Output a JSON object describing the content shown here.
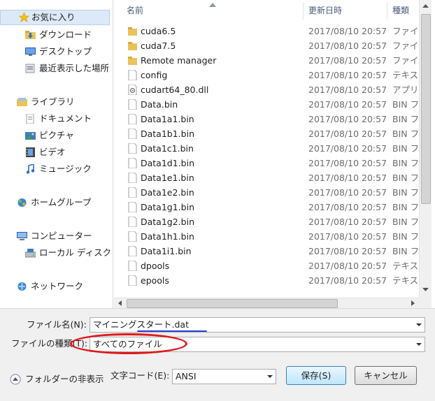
{
  "nav": {
    "favorites": "お気に入り",
    "downloads": "ダウンロード",
    "desktop": "デスクトップ",
    "recent": "最近表示した場所",
    "libraries": "ライブラリ",
    "documents": "ドキュメント",
    "pictures": "ピクチャ",
    "videos": "ビデオ",
    "music": "ミュージック",
    "homegroup": "ホームグループ",
    "computer": "コンピューター",
    "local_disk": "ローカル ディスク (C:)",
    "network": "ネットワーク"
  },
  "columns": {
    "name": "名前",
    "date": "更新日時",
    "type": "種類"
  },
  "files": [
    {
      "name": "cuda6.5",
      "date": "2017/08/10 20:57",
      "type": "ファイル フォルダー",
      "icon": "folder-icon"
    },
    {
      "name": "cuda7.5",
      "date": "2017/08/10 20:57",
      "type": "ファイル フォルダー",
      "icon": "folder-icon"
    },
    {
      "name": "Remote manager",
      "date": "2017/08/10 20:57",
      "type": "ファイル フォルダー",
      "icon": "folder-icon"
    },
    {
      "name": "config",
      "date": "2017/08/10 20:57",
      "type": "テキスト ドキュメント",
      "icon": "file-icon"
    },
    {
      "name": "cudart64_80.dll",
      "date": "2017/08/10 20:57",
      "type": "アプリケーション拡張",
      "icon": "dll-file-icon"
    },
    {
      "name": "Data.bin",
      "date": "2017/08/10 20:57",
      "type": "BIN ファイル",
      "icon": "file-icon"
    },
    {
      "name": "Data1a1.bin",
      "date": "2017/08/10 20:57",
      "type": "BIN ファイル",
      "icon": "file-icon"
    },
    {
      "name": "Data1b1.bin",
      "date": "2017/08/10 20:57",
      "type": "BIN ファイル",
      "icon": "file-icon"
    },
    {
      "name": "Data1c1.bin",
      "date": "2017/08/10 20:57",
      "type": "BIN ファイル",
      "icon": "file-icon"
    },
    {
      "name": "Data1d1.bin",
      "date": "2017/08/10 20:57",
      "type": "BIN ファイル",
      "icon": "file-icon"
    },
    {
      "name": "Data1e1.bin",
      "date": "2017/08/10 20:57",
      "type": "BIN ファイル",
      "icon": "file-icon"
    },
    {
      "name": "Data1e2.bin",
      "date": "2017/08/10 20:57",
      "type": "BIN ファイル",
      "icon": "file-icon"
    },
    {
      "name": "Data1g1.bin",
      "date": "2017/08/10 20:57",
      "type": "BIN ファイル",
      "icon": "file-icon"
    },
    {
      "name": "Data1g2.bin",
      "date": "2017/08/10 20:57",
      "type": "BIN ファイル",
      "icon": "file-icon"
    },
    {
      "name": "Data1h1.bin",
      "date": "2017/08/10 20:57",
      "type": "BIN ファイル",
      "icon": "file-icon"
    },
    {
      "name": "Data1i1.bin",
      "date": "2017/08/10 20:57",
      "type": "BIN ファイル",
      "icon": "file-icon"
    },
    {
      "name": "dpools",
      "date": "2017/08/10 20:57",
      "type": "テキスト ドキュメント",
      "icon": "file-icon"
    },
    {
      "name": "epools",
      "date": "2017/08/10 20:57",
      "type": "テキスト ドキュメント",
      "icon": "file-icon"
    }
  ],
  "form": {
    "filename_label": "ファイル名(N):",
    "filename_value": "マイニングスタート.dat",
    "filetype_label": "ファイルの種類(T):",
    "filetype_value": "すべてのファイル",
    "encoding_label": "文字コード(E):",
    "encoding_value": "ANSI",
    "hide_folders": "フォルダーの非表示",
    "save": "保存(S)",
    "cancel": "キャンセル"
  },
  "annotations": {
    "underline_color": "#2a3dd6",
    "ellipse_color": "#e01919"
  }
}
